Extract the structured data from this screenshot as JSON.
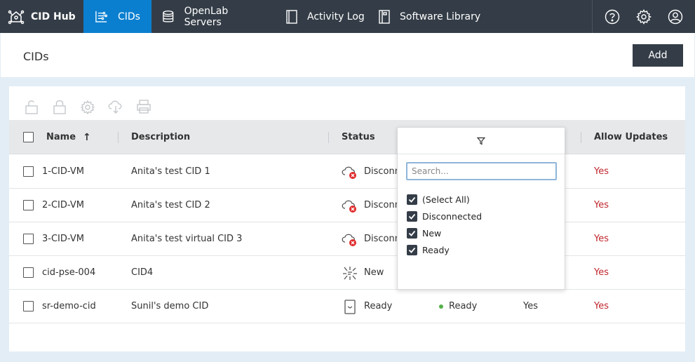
{
  "topbar": {
    "brand": "CID Hub",
    "nav": [
      {
        "label": "CIDs",
        "icon": "cids-icon",
        "active": true
      },
      {
        "label": "OpenLab Servers",
        "icon": "database-icon"
      },
      {
        "label": "Activity Log",
        "icon": "log-icon"
      },
      {
        "label": "Software Library",
        "icon": "library-icon"
      }
    ],
    "right_icons": [
      "help-icon",
      "gear-icon",
      "user-icon"
    ]
  },
  "header": {
    "title": "CIDs",
    "add_label": "Add"
  },
  "toolbar_icons": [
    "unlock-icon",
    "lock-icon",
    "settings-icon",
    "cloud-sync-icon",
    "print-icon"
  ],
  "table": {
    "columns": {
      "name": "Name",
      "description": "Description",
      "status": "Status",
      "allow_updates": "Allow Updates"
    },
    "sort_indicator": "↑",
    "rows": [
      {
        "name": "1-CID-VM",
        "description": "Anita's test CID 1",
        "status": "Disconn",
        "status_icon": "cloud-error-icon",
        "allow": "Yes"
      },
      {
        "name": "2-CID-VM",
        "description": "Anita's test CID 2",
        "status": "Disconn",
        "status_icon": "cloud-error-icon",
        "allow": "Yes"
      },
      {
        "name": "3-CID-VM",
        "description": "Anita's test virtual CID 3",
        "status": "Disconn",
        "status_icon": "cloud-error-icon",
        "allow": "Yes"
      },
      {
        "name": "cid-pse-004",
        "description": "CID4",
        "status": "New",
        "status_icon": "sparkle-icon",
        "allow": "Yes"
      },
      {
        "name": "sr-demo-cid",
        "description": "Sunil's demo CID",
        "status": "Ready",
        "status_icon": "device-icon",
        "extra_status": "Ready",
        "extra_value": "Yes",
        "allow": "Yes"
      }
    ]
  },
  "filter": {
    "search_placeholder": "Search...",
    "options": [
      "(Select All)",
      "Disconnected",
      "New",
      "Ready"
    ]
  },
  "colors": {
    "topbar": "#343d47",
    "active_nav": "#0a7fd0",
    "allow_yes": "#c0262d",
    "ready_dot": "#55b04a"
  }
}
